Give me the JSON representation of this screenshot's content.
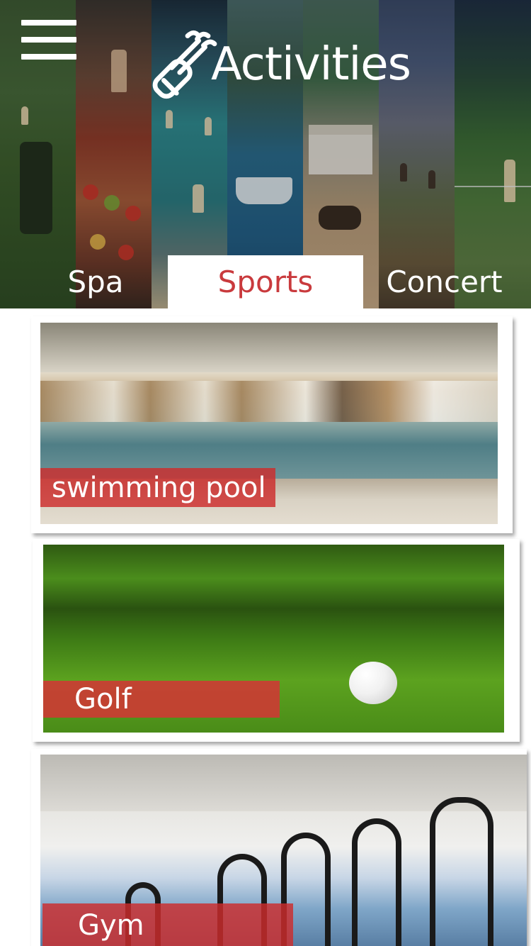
{
  "header": {
    "title": "Activities",
    "title_icon": "golf-bag-icon",
    "menu_icon": "hamburger-menu-icon"
  },
  "tabs": [
    {
      "label": "Spa",
      "selected": false
    },
    {
      "label": "Sports",
      "selected": true
    },
    {
      "label": "Concert",
      "selected": false
    }
  ],
  "activities": [
    {
      "label": "swimming pool"
    },
    {
      "label": "Golf"
    },
    {
      "label": "Gym"
    }
  ],
  "colors": {
    "accent_red": "#c93a3d",
    "label_bg": "#cd2c2c",
    "tab_active_bg": "#ffffff",
    "header_text": "#ffffff"
  }
}
